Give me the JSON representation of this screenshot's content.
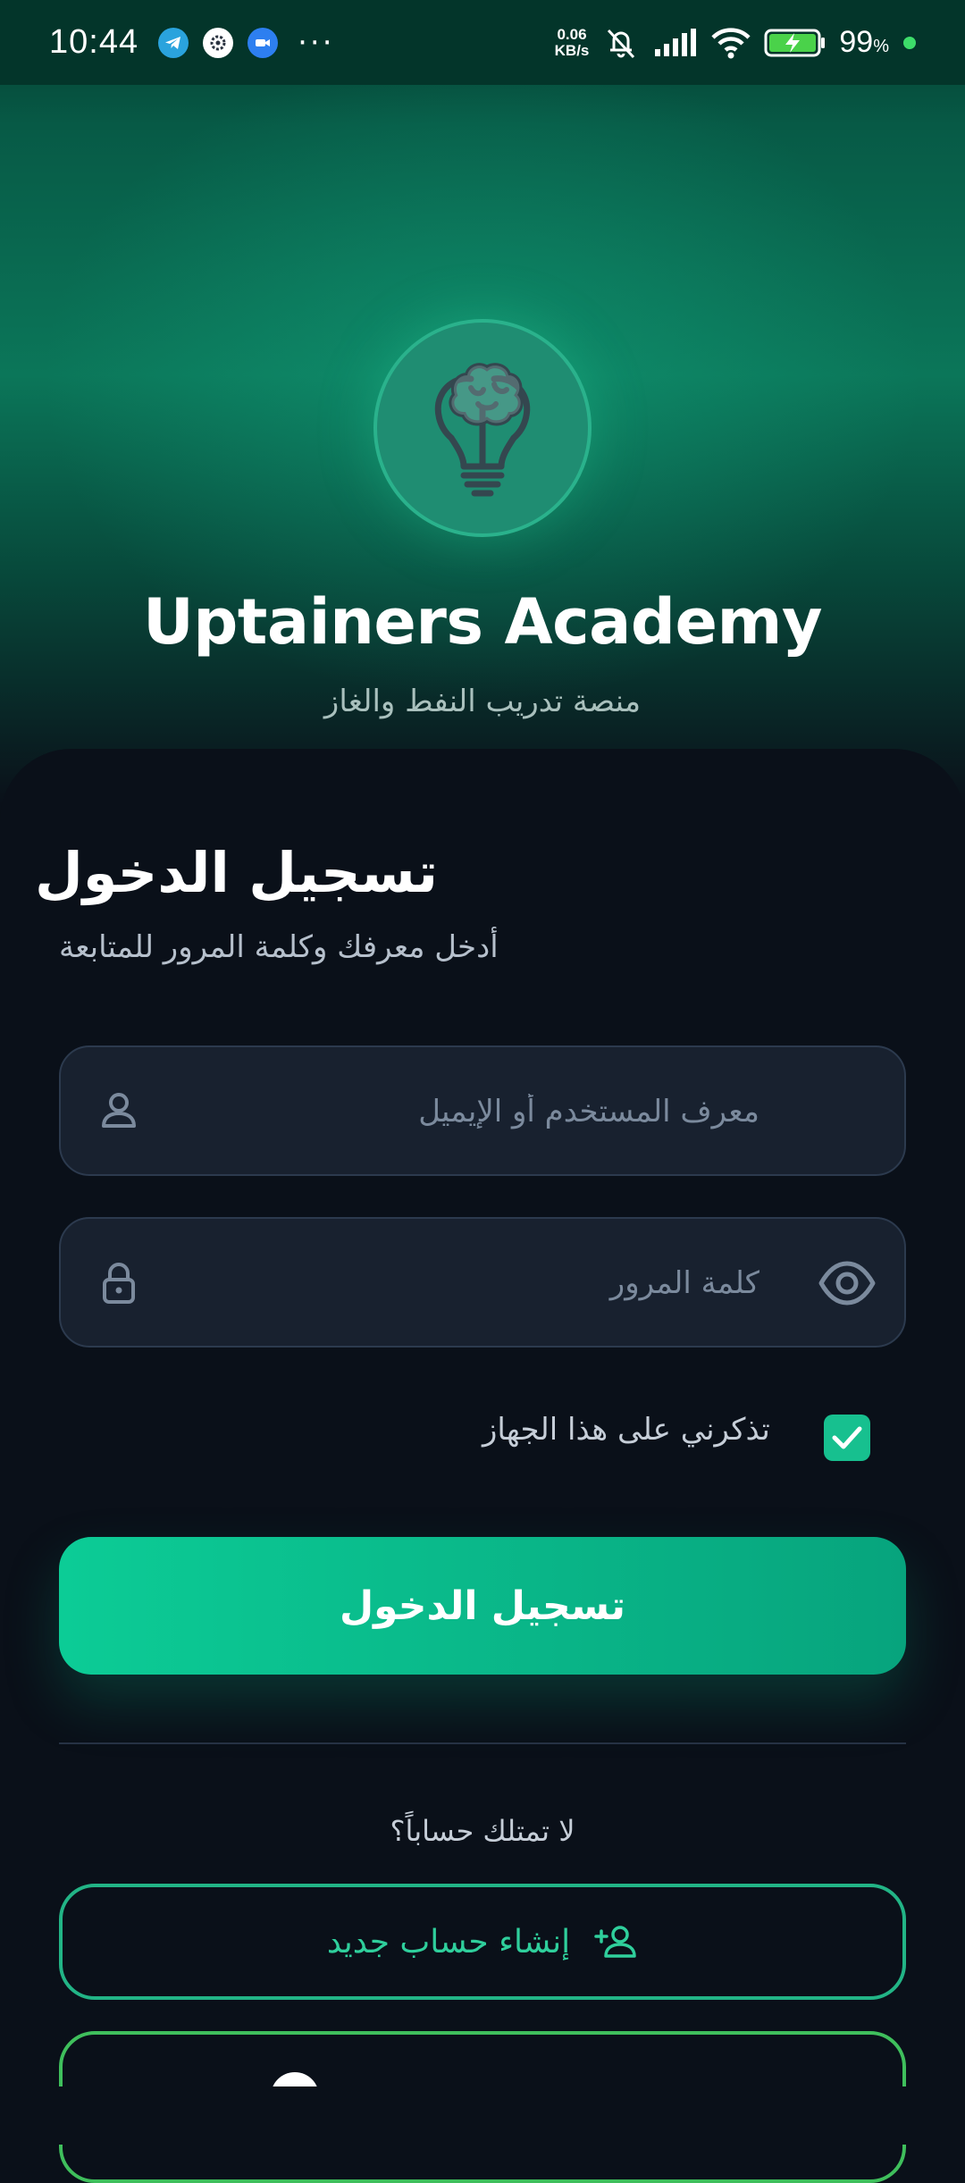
{
  "status_bar": {
    "time": "10:44",
    "apps": [
      "telegram-icon",
      "settings-icon",
      "zoom-icon"
    ],
    "more": "···",
    "net_speed_value": "0.06",
    "net_speed_unit": "KB/s",
    "battery_percent": "99",
    "battery_symbol": "%"
  },
  "hero": {
    "logo_icon": "brain-bulb-icon",
    "brand": "Uptainers Academy",
    "tagline": "منصة تدريب النفط والغاز"
  },
  "login": {
    "title": "تسجيل الدخول",
    "subtitle": "أدخل معرفك وكلمة المرور للمتابعة",
    "username": {
      "value": "",
      "placeholder": "معرف المستخدم أو الإيميل"
    },
    "password": {
      "value": "",
      "placeholder": "كلمة المرور"
    },
    "remember_label": "تذكرني على هذا الجهاز",
    "remember_checked": true,
    "submit_label": "تسجيل الدخول"
  },
  "signup": {
    "prompt": "لا تمتلك حساباً؟",
    "create_label": "إنشاء حساب جديد"
  },
  "colors": {
    "accent": "#0ccc96",
    "background": "#0a1019",
    "field_bg": "#18212f"
  }
}
